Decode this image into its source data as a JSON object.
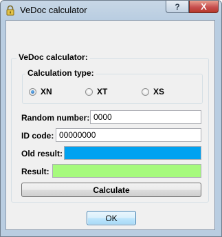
{
  "window": {
    "title": "VeDoc calculator",
    "help_label": "?",
    "close_label": "X"
  },
  "main_group": {
    "label": "VeDoc calculator:"
  },
  "calc_type": {
    "label": "Calculation type:",
    "options": [
      {
        "label": "XN",
        "checked": true
      },
      {
        "label": "XT",
        "checked": false
      },
      {
        "label": "XS",
        "checked": false
      }
    ]
  },
  "fields": {
    "random_number": {
      "label": "Random number:",
      "value": "0000"
    },
    "id_code": {
      "label": "ID code:",
      "value": "00000000"
    },
    "old_result": {
      "label": "Old result:",
      "value": "",
      "color": "#00a2f0"
    },
    "result": {
      "label": "Result:",
      "value": "",
      "color": "#a6fa7d"
    }
  },
  "buttons": {
    "calculate": "Calculate",
    "ok": "OK"
  }
}
